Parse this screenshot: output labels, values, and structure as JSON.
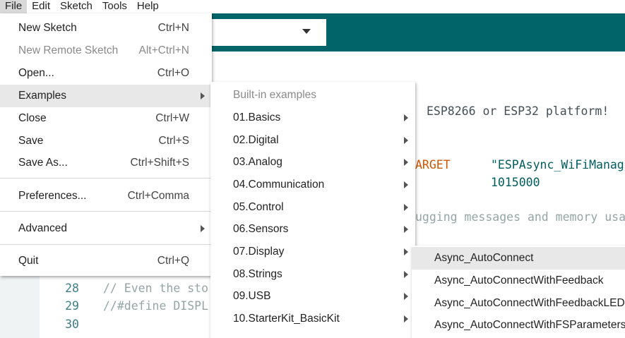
{
  "menubar": {
    "items": [
      "File",
      "Edit",
      "Sketch",
      "Tools",
      "Help"
    ]
  },
  "editor": {
    "line28": {
      "num": "28",
      "text": "// Even the sto"
    },
    "line29": {
      "num": "29",
      "text": "//#define DISPL"
    },
    "line30": {
      "num": "30",
      "text": ""
    },
    "frag_platform": "ESP8266 or ESP32 platform!",
    "frag_target": "ARGET",
    "frag_string": "\"ESPAsync_WiFiManag",
    "frag_number": "1015000",
    "frag_debug": "ugging messages and memory usa"
  },
  "file_menu": {
    "items": [
      {
        "label": "New Sketch",
        "shortcut": "Ctrl+N"
      },
      {
        "label": "New Remote Sketch",
        "shortcut": "Alt+Ctrl+N"
      },
      {
        "label": "Open...",
        "shortcut": "Ctrl+O"
      },
      {
        "label": "Examples",
        "shortcut": ""
      },
      {
        "label": "Close",
        "shortcut": "Ctrl+W"
      },
      {
        "label": "Save",
        "shortcut": "Ctrl+S"
      },
      {
        "label": "Save As...",
        "shortcut": "Ctrl+Shift+S"
      },
      {
        "label": "Preferences...",
        "shortcut": "Ctrl+Comma"
      },
      {
        "label": "Advanced",
        "shortcut": ""
      },
      {
        "label": "Quit",
        "shortcut": "Ctrl+Q"
      }
    ]
  },
  "examples_menu": {
    "header": "Built-in examples",
    "items": [
      "01.Basics",
      "02.Digital",
      "03.Analog",
      "04.Communication",
      "05.Control",
      "06.Sensors",
      "07.Display",
      "08.Strings",
      "09.USB",
      "10.StarterKit_BasicKit"
    ]
  },
  "display_menu": {
    "items": [
      "Async_AutoConnect",
      "Async_AutoConnectWithFeedback",
      "Async_AutoConnectWithFeedbackLED",
      "Async_AutoConnectWithFSParameters"
    ]
  }
}
